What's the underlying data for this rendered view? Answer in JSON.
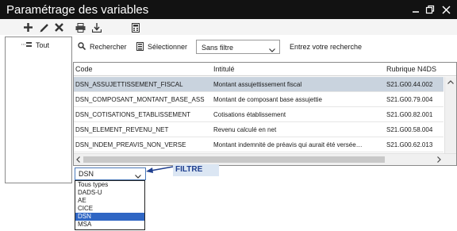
{
  "window": {
    "title": "Paramétrage des variables",
    "controls": [
      "minimize-icon",
      "restore-icon",
      "close-icon"
    ]
  },
  "toolbar": {
    "icons": [
      "add-icon",
      "edit-icon",
      "delete-icon",
      "print-icon",
      "export-icon",
      "calculator-icon"
    ]
  },
  "tree": {
    "items": [
      {
        "label": "Tout",
        "icon": "tree-root-icon"
      }
    ]
  },
  "search_bar": {
    "search_label": "Rechercher",
    "select_label": "Sélectionner",
    "filter_value": "Sans filtre",
    "search_placeholder": "Entrez votre recherche"
  },
  "grid": {
    "columns": [
      "Code",
      "Intitulé",
      "Rubrique N4DS"
    ],
    "rows": [
      {
        "code": "DSN_ASSUJETTISSEMENT_FISCAL",
        "label": "Montant assujettissement fiscal",
        "rubrique": "S21.G00.44.002",
        "selected": true
      },
      {
        "code": "DSN_COMPOSANT_MONTANT_BASE_ASS",
        "label": "Montant de composant base assujettie",
        "rubrique": "S21.G00.79.004",
        "selected": false
      },
      {
        "code": "DSN_COTISATIONS_ETABLISSEMENT",
        "label": "Cotisations établissement",
        "rubrique": "S21.G00.82.001",
        "selected": false
      },
      {
        "code": "DSN_ELEMENT_REVENU_NET",
        "label": "Revenu calculé en net",
        "rubrique": "S21.G00.58.004",
        "selected": false
      },
      {
        "code": "DSN_INDEM_PREAVIS_NON_VERSE",
        "label": "Montant indemnité de préavis qui aurait été versée…",
        "rubrique": "S21.G00.62.013",
        "selected": false
      }
    ]
  },
  "dropdown": {
    "selected_value": "DSN",
    "options": [
      "Tous types",
      "DADS-U",
      "AE",
      "CICE",
      "DSN",
      "MSA"
    ],
    "highlighted_index": 4
  },
  "annotation": {
    "label": "FILTRE"
  },
  "colors": {
    "titlebar": "#121212",
    "row_selected": "#c9d3de",
    "option_selected": "#2f66c4",
    "callout_bg": "#dbe6f3",
    "callout_text": "#1f3f8f"
  }
}
